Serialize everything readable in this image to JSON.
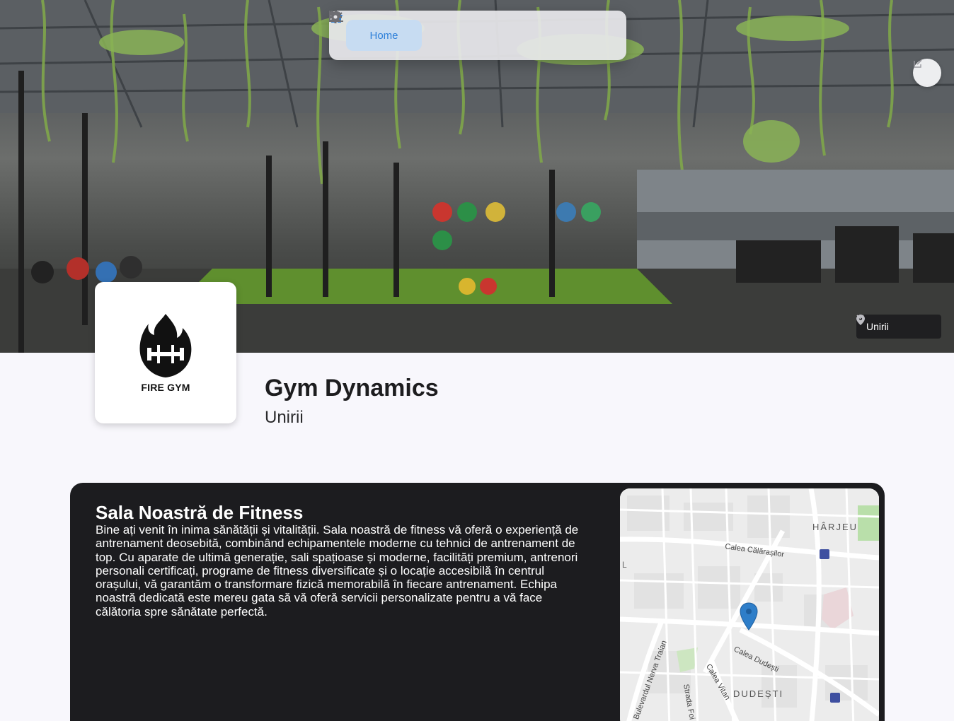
{
  "nav": {
    "home_label": "Home",
    "items": [
      "home-icon",
      "dumbbell-icon",
      "calendar-icon",
      "chart-icon",
      "gear-icon"
    ],
    "active_color": "#2f80d9"
  },
  "hero": {
    "location_select": {
      "value": "Unirii"
    }
  },
  "gym": {
    "logo_text": "FIRE GYM",
    "name": "Gym Dynamics",
    "branch": "Unirii"
  },
  "about": {
    "title": "Sala Noastră de Fitness",
    "body": "Bine ați venit în inima sănătății și vitalității. Sala noastră de fitness vă oferă o experiență de antrenament deosebită, combinând echipamentele moderne cu tehnici de antrenament de top. Cu aparate de ultimă generație, sali spațioase și moderne, facilități premium, antrenori personali certificați, programe de fitness diversificate și o locație accesibilă în centrul orașului, vă garantăm o transformare fizică memorabilă în fiecare antrenament. Echipa noastră dedicată este mereu gata să vă oferă servicii personalizate pentru a vă face călătoria spre sănătate perfectă."
  },
  "map": {
    "district_1": "HÂRJEU",
    "district_2": "DUDEȘTI",
    "street_1": "Calea Călărașilor",
    "street_2": "Calea Dudești",
    "street_3": "Bulevardul Nerva Traian",
    "street_4": "Calea Vitan",
    "street_5": "Strada Foi",
    "edge_label": "L"
  }
}
